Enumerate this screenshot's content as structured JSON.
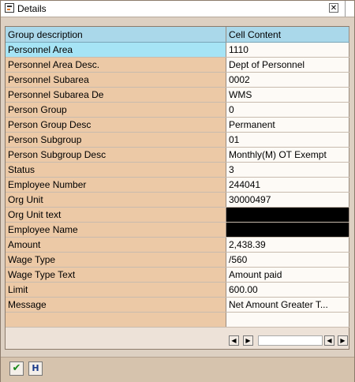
{
  "window": {
    "title": "Details"
  },
  "grid": {
    "columns": [
      "Group description",
      "Cell Content"
    ],
    "rows": [
      {
        "label": "Personnel Area",
        "value": "1110",
        "selected": true
      },
      {
        "label": "Personnel Area Desc.",
        "value": "Dept of Personnel"
      },
      {
        "label": "Personnel Subarea",
        "value": "0002"
      },
      {
        "label": "Personnel Subarea De",
        "value": "WMS"
      },
      {
        "label": "Person Group",
        "value": "0"
      },
      {
        "label": "Person Group Desc",
        "value": "Permanent"
      },
      {
        "label": "Person Subgroup",
        "value": "01"
      },
      {
        "label": "Person Subgroup Desc",
        "value": "Monthly(M) OT Exempt"
      },
      {
        "label": "Status",
        "value": "3"
      },
      {
        "label": "Employee Number",
        "value": "244041"
      },
      {
        "label": "Org Unit",
        "value": "30000497"
      },
      {
        "label": "Org Unit text",
        "value": "",
        "masked": true
      },
      {
        "label": "Employee Name",
        "value": "",
        "masked": true
      },
      {
        "label": "Amount",
        "value": "2,438.39"
      },
      {
        "label": "Wage Type",
        "value": "/560"
      },
      {
        "label": "Wage Type Text",
        "value": "Amount paid"
      },
      {
        "label": "Limit",
        "value": "600.00"
      },
      {
        "label": "Message",
        "value": "Net Amount Greater T..."
      }
    ]
  },
  "scrollbar": {
    "left_icon": "scroll-left-icon",
    "right_icon": "scroll-right-icon"
  },
  "footer": {
    "ok_icon": "checkmark-icon",
    "find_icon": "find-icon"
  }
}
